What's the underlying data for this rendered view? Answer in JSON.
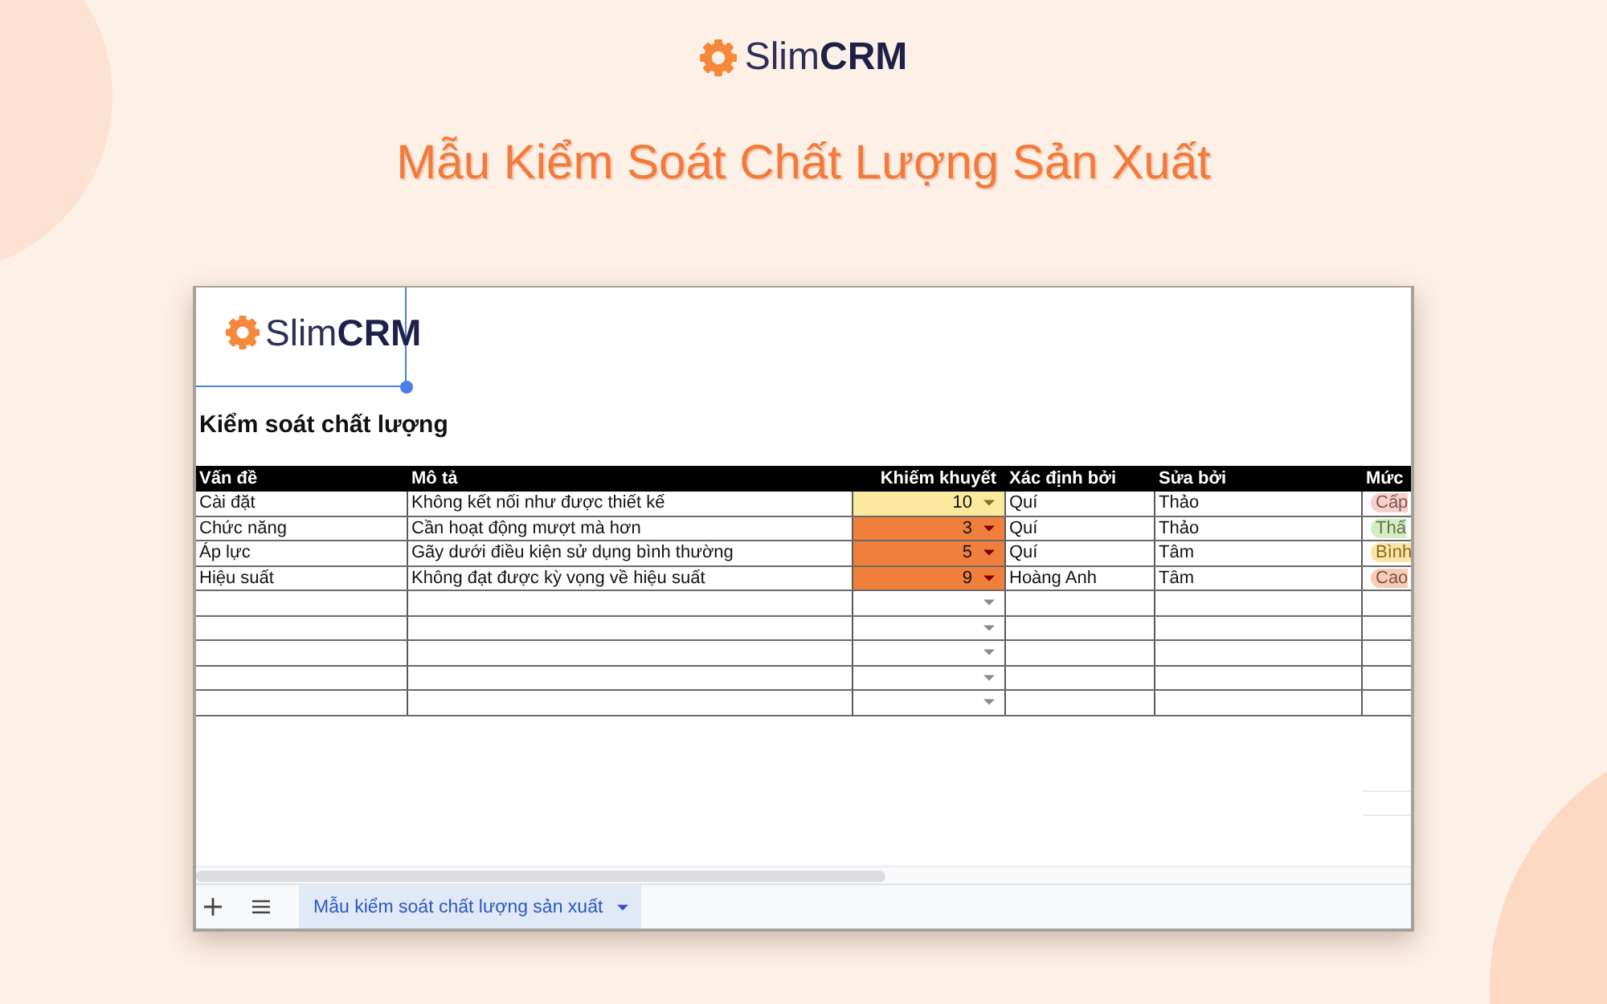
{
  "header": {
    "logo": "Slim**CRM**",
    "title": "Mẫu Kiểm Soát Chất Lượng Sản Xuất"
  },
  "sheet": {
    "logo": "Slim**CRM**",
    "heading": "Kiểm soát chất lượng",
    "table": {
      "columns": [
        "Vấn đề",
        "Mô tả",
        "Khiếm khuyết",
        "Xác định bởi",
        "Sửa bởi",
        "Mức"
      ],
      "rows": [
        {
          "kind": "data",
          "issue": "Cài đặt",
          "description": "Không kết nối như được thiết kế",
          "defects": {
            "value": "10",
            "color": "#fbe99d"
          },
          "identified_by": "Quí",
          "fixed_by": "Thảo",
          "severity": {
            "label": "Cấp",
            "color": "#f7d0cc"
          }
        },
        {
          "kind": "data",
          "issue": "Chức năng",
          "description": "Cần hoạt động mượt mà hơn",
          "defects": {
            "value": "3",
            "color": "#ef7f3b"
          },
          "identified_by": "Quí",
          "fixed_by": "Thảo",
          "severity": {
            "label": "Thấ",
            "color": "#d6ecc2"
          }
        },
        {
          "kind": "data",
          "issue": "Áp lực",
          "description": "Gãy dưới điều kiện sử dụng bình thường",
          "defects": {
            "value": "5",
            "color": "#ef7f3b"
          },
          "identified_by": "Quí",
          "fixed_by": "Tâm",
          "severity": {
            "label": "Bình",
            "color": "#fce3a6"
          }
        },
        {
          "kind": "data",
          "issue": "Hiệu suất",
          "description": "Không đạt được kỳ vọng về hiệu suất",
          "defects": {
            "value": "9",
            "color": "#ef7f3b"
          },
          "identified_by": "Hoàng Anh",
          "fixed_by": "Tâm",
          "severity": {
            "label": "Cao",
            "color": "#f6cdb8"
          }
        },
        {
          "kind": "empty"
        },
        {
          "kind": "empty"
        },
        {
          "kind": "empty"
        },
        {
          "kind": "empty"
        },
        {
          "kind": "empty"
        }
      ]
    },
    "sheet_tabs": [
      {
        "label": "Mẫu kiểm soát chất lượng sản xuất",
        "selected": true
      }
    ]
  }
}
